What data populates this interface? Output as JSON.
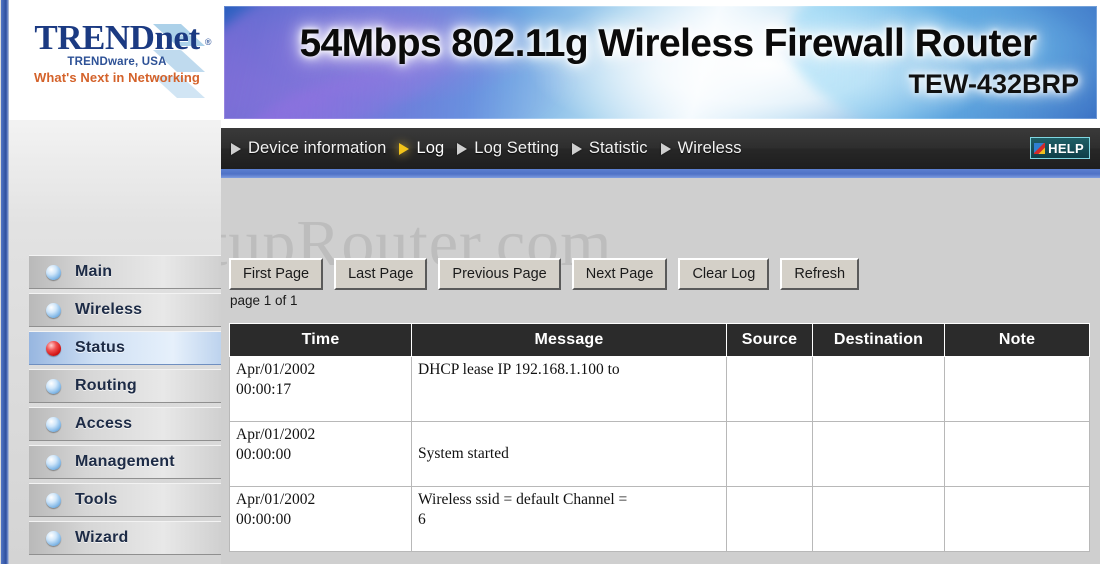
{
  "brand": {
    "name_part1": "TREND",
    "name_part2": "net",
    "registered": "®",
    "tagline1": "TRENDware, USA",
    "tagline2": "What's Next in Networking"
  },
  "banner": {
    "title": "54Mbps 802.11g Wireless Firewall Router",
    "model": "TEW-432BRP"
  },
  "nav": {
    "items": [
      {
        "label": "Device information",
        "active": false
      },
      {
        "label": "Log",
        "active": true
      },
      {
        "label": "Log Setting",
        "active": false
      },
      {
        "label": "Statistic",
        "active": false
      },
      {
        "label": "Wireless",
        "active": false
      }
    ],
    "help_label": "HELP",
    "help_icon": "help-icon"
  },
  "sidebar": {
    "items": [
      {
        "label": "Main",
        "active": false,
        "icon": "blue-bullet-icon"
      },
      {
        "label": "Wireless",
        "active": false,
        "icon": "blue-bullet-icon"
      },
      {
        "label": "Status",
        "active": true,
        "icon": "red-bullet-icon"
      },
      {
        "label": "Routing",
        "active": false,
        "icon": "blue-bullet-icon"
      },
      {
        "label": "Access",
        "active": false,
        "icon": "blue-bullet-icon"
      },
      {
        "label": "Management",
        "active": false,
        "icon": "blue-bullet-icon"
      },
      {
        "label": "Tools",
        "active": false,
        "icon": "blue-bullet-icon"
      },
      {
        "label": "Wizard",
        "active": false,
        "icon": "blue-bullet-icon"
      }
    ]
  },
  "toolbar": {
    "buttons": [
      "First Page",
      "Last Page",
      "Previous Page",
      "Next Page",
      "Clear Log",
      "Refresh"
    ]
  },
  "page_info": "page 1 of 1",
  "watermark": "SetupRouter.com",
  "log_table": {
    "headers": [
      "Time",
      "Message",
      "Source",
      "Destination",
      "Note"
    ],
    "rows": [
      {
        "time": "Apr/01/2002\n00:00:17",
        "message": "DHCP lease IP 192.168.1.100 to",
        "source": "",
        "destination": "",
        "note": "",
        "msg_align": "top"
      },
      {
        "time": "Apr/01/2002\n00:00:00",
        "message": "System started",
        "source": "",
        "destination": "",
        "note": "",
        "msg_align": "middle"
      },
      {
        "time": "Apr/01/2002\n00:00:00",
        "message": "Wireless ssid = default Channel =\n6",
        "source": "",
        "destination": "",
        "note": "",
        "msg_align": "top"
      }
    ]
  },
  "colors": {
    "accent_blue": "#4f72c6",
    "nav_bar": "#2b2b2b",
    "active_red": "#d01010",
    "banner_blue": "#3f7fd0",
    "brand_navy": "#1b3a82",
    "brand_orange": "#d4622a"
  }
}
